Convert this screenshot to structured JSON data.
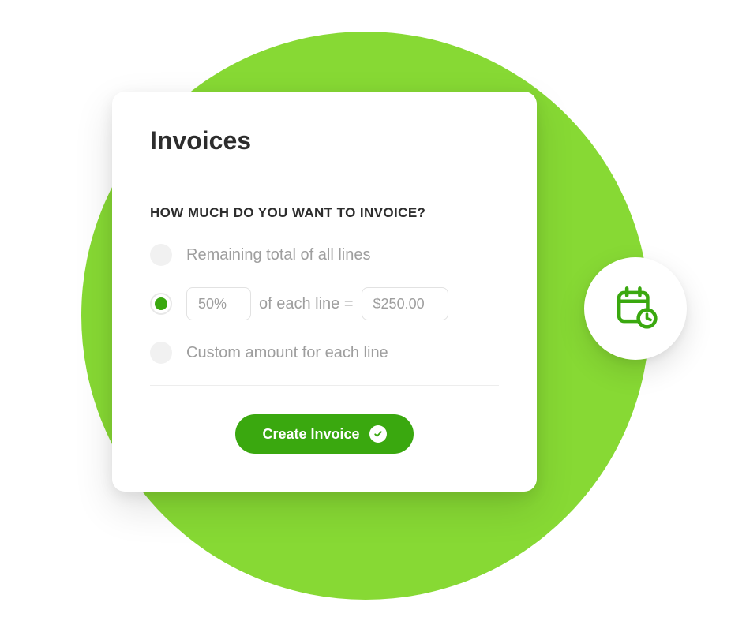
{
  "colors": {
    "accent_bg": "#87d934",
    "primary": "#3aa80f"
  },
  "card": {
    "title": "Invoices",
    "prompt": "HOW MUCH DO YOU WANT TO INVOICE?",
    "options": {
      "remaining": "Remaining total of all lines",
      "percent_value": "50%",
      "percent_mid": "of each line =",
      "percent_amount": "$250.00",
      "custom": "Custom amount for each line"
    },
    "button": "Create Invoice"
  }
}
